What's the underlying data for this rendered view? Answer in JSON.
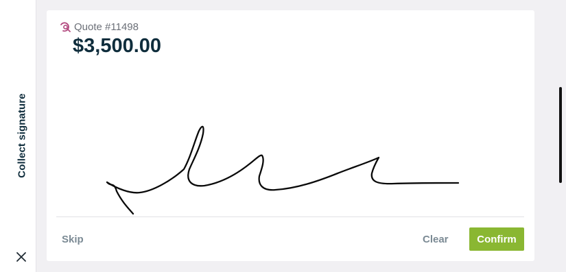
{
  "sidebar": {
    "title": "Collect signature",
    "close_icon": "close-icon"
  },
  "quote": {
    "icon": "quote-icon",
    "label": "Quote #11498",
    "amount": "$3,500.00"
  },
  "actions": {
    "skip_label": "Skip",
    "clear_label": "Clear",
    "confirm_label": "Confirm"
  },
  "colors": {
    "background": "#f1f0f3",
    "primary_text": "#0f2d3c",
    "muted_text": "#7b8a94",
    "confirm": "#8ab732",
    "quote_icon": "#b2497f"
  }
}
